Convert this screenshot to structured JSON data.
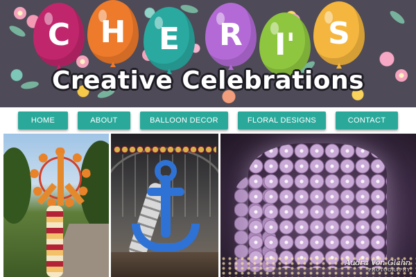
{
  "header": {
    "balloon_letters": [
      {
        "letter": "C",
        "color": "#c0266c"
      },
      {
        "letter": "H",
        "color": "#ee7a2b"
      },
      {
        "letter": "E",
        "color": "#29a9a0"
      },
      {
        "letter": "R",
        "color": "#b36ad6"
      },
      {
        "letter": "I'",
        "color": "#8fc63f"
      },
      {
        "letter": "S",
        "color": "#f4b63e"
      }
    ],
    "brand_name": "Creative Celebrations"
  },
  "nav": {
    "items": [
      {
        "label": "HOME"
      },
      {
        "label": "ABOUT"
      },
      {
        "label": "BALLOON DECOR"
      },
      {
        "label": "FLORAL DESIGNS"
      },
      {
        "label": "CONTACT"
      }
    ],
    "accent_color": "#2aa99b"
  },
  "gallery": {
    "watermark_name": "Audra Von Glahn",
    "watermark_sub": "PHOTOGRAPHY"
  }
}
